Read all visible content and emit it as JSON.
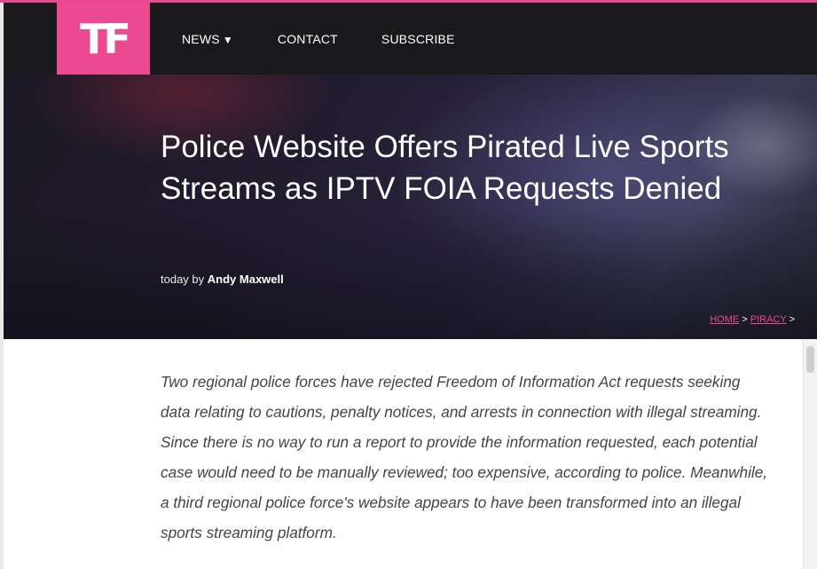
{
  "header": {
    "logo_text": "TF",
    "nav": {
      "news": "NEWS",
      "news_caret": "▼",
      "contact": "CONTACT",
      "subscribe": "SUBSCRIBE"
    }
  },
  "article": {
    "title": "Police Website Offers Pirated Live Sports Streams as IPTV FOIA Requests Denied",
    "byline_prefix": "today by",
    "author": "Andy Maxwell",
    "breadcrumb": {
      "home": "HOME",
      "sep1": " > ",
      "category": "PIRACY",
      "sep2": " >"
    },
    "lead": "Two regional police forces have rejected Freedom of Information Act requests seeking data relating to cautions, penalty notices, and arrests in connection with illegal streaming. Since there is no way to run a report to provide the information requested, each potential case would need to be manually reviewed; too expensive, according to police. Meanwhile, a third regional police force's website appears to have been transformed into an illegal sports streaming platform."
  },
  "colors": {
    "accent": "#ec4a90",
    "topbar": "#1a1a1d"
  }
}
